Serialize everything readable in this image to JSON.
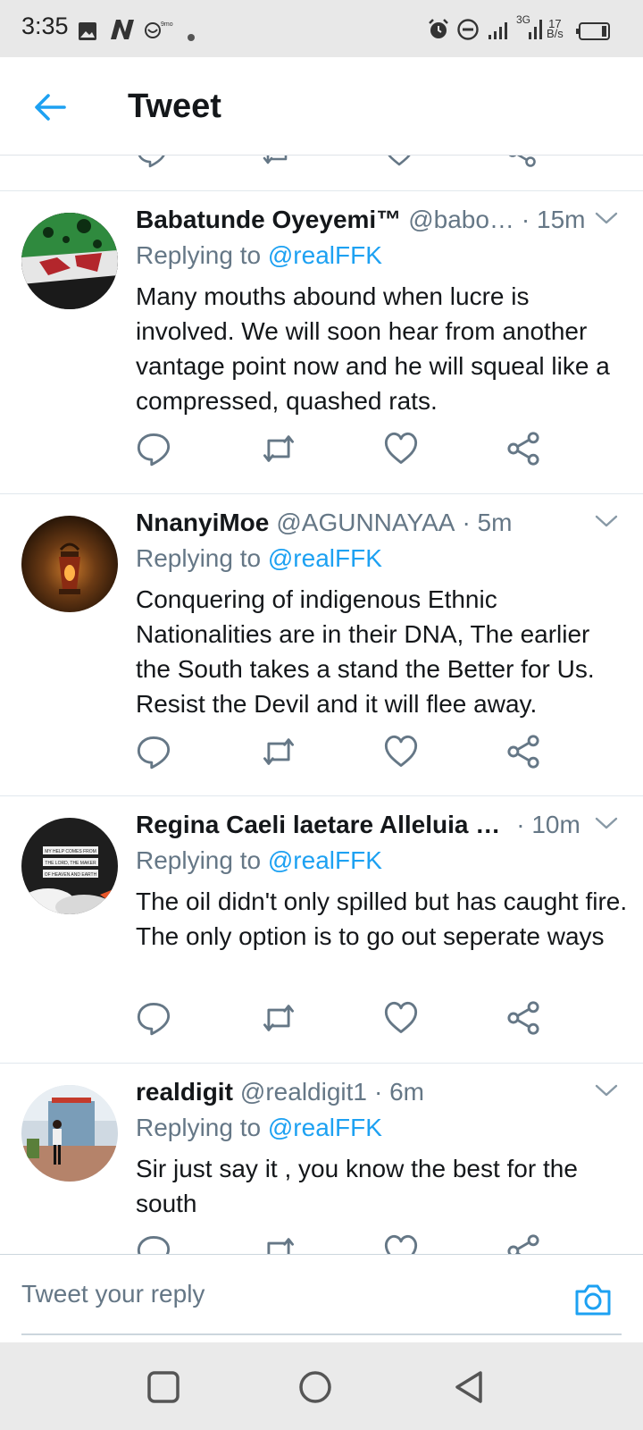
{
  "status_bar": {
    "time": "3:35",
    "network": "3G",
    "speed_value": "17",
    "speed_unit": "B/s",
    "icons": [
      "image-icon",
      "n-app-icon",
      "notification-app-icon",
      "dot-icon",
      "alarm-icon",
      "dnd-icon",
      "signal-icon",
      "signal-3g-icon",
      "battery-icon"
    ]
  },
  "header": {
    "title": "Tweet",
    "back_icon": "arrow-left-icon"
  },
  "colors": {
    "accent": "#1da1f2",
    "secondary_text": "#657786",
    "primary_text": "#14171a"
  },
  "tweets": [
    {
      "name": "Babatunde Oyeyemi™",
      "handle": "@babo…",
      "time": "· 15m",
      "replying_prefix": "Replying to",
      "replying_to": "@realFFK",
      "text": "Many mouths abound when lucre is involved. We will soon hear from another vantage point now and he will squeal like a compressed, quashed rats."
    },
    {
      "name": "NnanyiMoe",
      "handle": "@AGUNNAYAA",
      "time": "· 5m",
      "replying_prefix": "Replying to",
      "replying_to": "@realFFK",
      "text": "Conquering of indigenous Ethnic Nationalities are in their DNA, The earlier the South takes a stand the Better for Us. Resist the Devil and it will flee away."
    },
    {
      "name": "Regina Caeli laetare Alleluia …",
      "handle": "",
      "time": "· 10m",
      "replying_prefix": "Replying to",
      "replying_to": "@realFFK",
      "text": "The oil didn't only spilled but has caught fire. The only option is to go out seperate ways",
      "avatar_lines": [
        "MY HELP COMES FROM",
        "THE LORD, THE MAKER",
        "OF HEAVEN AND EARTH"
      ]
    },
    {
      "name": "realdigit",
      "handle": "@realdigit1",
      "time": "· 6m",
      "replying_prefix": "Replying to",
      "replying_to": "@realFFK",
      "text": "Sir just say it , you know the best for the south"
    }
  ],
  "action_icons": [
    "reply-icon",
    "retweet-icon",
    "like-icon",
    "share-icon"
  ],
  "reply_bar": {
    "placeholder": "Tweet your reply",
    "camera_icon": "camera-icon"
  },
  "nav_bar": {
    "buttons": [
      "recents-square-icon",
      "home-circle-icon",
      "back-triangle-icon"
    ]
  }
}
